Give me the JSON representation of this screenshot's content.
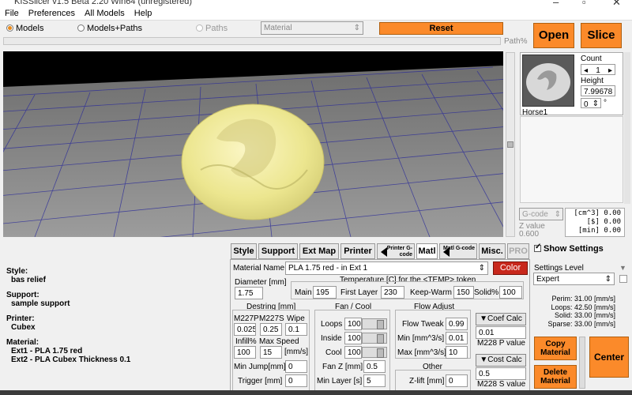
{
  "window": {
    "title": "KISSlicer v1.5 Beta 2.20 Win64 (unregistered)"
  },
  "menu": [
    "File",
    "Preferences",
    "All Models",
    "Help"
  ],
  "toolbar": {
    "radio_models": "Models",
    "radio_models_paths": "Models+Paths",
    "radio_paths": "Paths",
    "material_select": "Material",
    "reset": "Reset",
    "path_pct": "Path%",
    "open": "Open",
    "slice": "Slice"
  },
  "model_panel": {
    "count_label": "Count",
    "count_value": "1",
    "height_label": "Height",
    "height_value": "7.99678",
    "rotation_value": "0",
    "rotation_unit": "°",
    "model_name": "Horse1"
  },
  "stats": {
    "gcode_select": "G-code",
    "z_label": "Z value",
    "z_value": "0.600",
    "line1": "[cm^3] 0.00",
    "line2": "[$] 0.00",
    "line3": "[min] 0.00"
  },
  "show_settings": "Show Settings",
  "settings_level": {
    "label": "Settings Level",
    "value": "Expert"
  },
  "speeds": [
    "Perim: 31.00 [mm/s]",
    "Loops: 42.50 [mm/s]",
    "Solid: 33.00 [mm/s]",
    "Sparse: 33.00 [mm/s]"
  ],
  "buttons": {
    "copy_material": "Copy Material",
    "delete_material": "Delete Material",
    "center": "Center"
  },
  "left_summary": {
    "style_label": "Style:",
    "style_value": "bas relief",
    "support_label": "Support:",
    "support_value": "sample support",
    "printer_label": "Printer:",
    "printer_value": "Cubex",
    "material_label": "Material:",
    "ext1": "Ext1 - PLA 1.75 red",
    "ext2": "Ext2 - PLA Cubex Thickness 0.1"
  },
  "tabs": {
    "style": "Style",
    "support": "Support",
    "ext_map": "Ext Map",
    "printer": "Printer",
    "printer_gcode": "Printer G-code",
    "matl": "Matl",
    "matl_gcode": "Matl G-code",
    "misc": "Misc.",
    "pro": "PRO"
  },
  "material": {
    "name_label": "Material Name",
    "name_value": "PLA 1.75 red - in Ext 1",
    "color_button": "Color",
    "diameter_label": "Diameter [mm]",
    "diameter_value": "1.75",
    "temp_header": "Temperature [C] for the <TEMP> token",
    "main_label": "Main",
    "main_value": "195",
    "first_layer_label": "First Layer",
    "first_layer_value": "230",
    "keep_warm_label": "Keep-Warm",
    "keep_warm_value": "150",
    "solid_pct_label": "Solid%",
    "solid_pct_value": "100",
    "destring_header": "Destring [mm]",
    "m227p_label": "M227P",
    "m227p_value": "0.025",
    "m227s_label": "M227S",
    "m227s_value": "0.25",
    "wipe_label": "Wipe",
    "wipe_value": "0.1",
    "infill_label": "Infill%",
    "infill_value": "100",
    "max_speed_label": "Max Speed",
    "max_speed_value": "15",
    "max_speed_unit": "[mm/s]",
    "min_jump_label": "Min Jump[mm]",
    "min_jump_value": "0",
    "trigger_label": "Trigger [mm]",
    "trigger_value": "0",
    "fan_header": "Fan / Cool",
    "loops_label": "Loops",
    "loops_value": "100",
    "inside_label": "Inside",
    "inside_value": "100",
    "cool_label": "Cool",
    "cool_value": "100",
    "fan_z_label": "Fan Z [mm]",
    "fan_z_value": "0.5",
    "min_layer_label": "Min Layer [s]",
    "min_layer_value": "5",
    "flow_header": "Flow Adjust",
    "flow_tweak_label": "Flow Tweak",
    "flow_tweak_value": "0.99",
    "min_flow_label": "Min [mm^3/s]",
    "min_flow_value": "0.01",
    "max_flow_label": "Max [mm^3/s]",
    "max_flow_value": "10",
    "other_header": "Other",
    "zlift_label": "Z-lift [mm]",
    "zlift_value": "0",
    "coef_calc": "Coef Calc",
    "coef_value": "0.01",
    "m228p": "M228 P value",
    "cost_calc": "Cost Calc",
    "cost_value": "0.5",
    "m228s": "M228 S value"
  }
}
